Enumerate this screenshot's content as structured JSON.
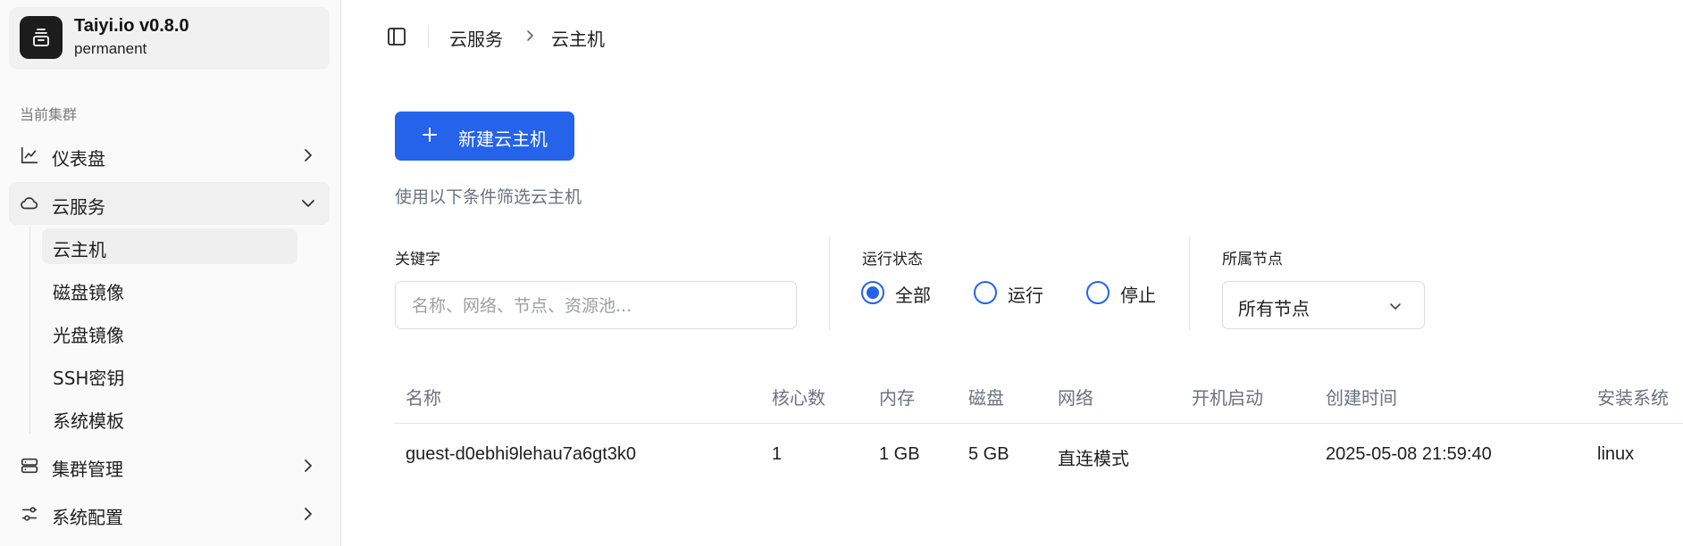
{
  "app": {
    "name": "Taiyi.io v0.8.0",
    "subtitle": "permanent"
  },
  "sidebar": {
    "section_label": "当前集群",
    "items": [
      {
        "label": "仪表盘",
        "icon": "chart-line-icon"
      },
      {
        "label": "云服务",
        "icon": "cloud-icon"
      },
      {
        "label": "集群管理",
        "icon": "server-icon"
      },
      {
        "label": "系统配置",
        "icon": "sliders-icon"
      }
    ],
    "subitems": [
      {
        "label": "云主机"
      },
      {
        "label": "磁盘镜像"
      },
      {
        "label": "光盘镜像"
      },
      {
        "label": "SSH密钥"
      },
      {
        "label": "系统模板"
      }
    ]
  },
  "breadcrumb": {
    "parent": "云服务",
    "current": "云主机"
  },
  "toolbar": {
    "new_button": "新建云主机"
  },
  "filters": {
    "hint": "使用以下条件筛选云主机",
    "keyword": {
      "label": "关键字",
      "placeholder": "名称、网络、节点、资源池..."
    },
    "status": {
      "label": "运行状态",
      "options": [
        {
          "label": "全部",
          "selected": true
        },
        {
          "label": "运行",
          "selected": false
        },
        {
          "label": "停止",
          "selected": false
        }
      ]
    },
    "node": {
      "label": "所属节点",
      "value": "所有节点"
    }
  },
  "table": {
    "headers": [
      "名称",
      "核心数",
      "内存",
      "磁盘",
      "网络",
      "开机启动",
      "创建时间",
      "安装系统"
    ],
    "rows": [
      [
        "guest-d0ebhi9lehau7a6gt3k0",
        "1",
        "1 GB",
        "5 GB",
        "直连模式",
        "",
        "2025-05-08 21:59:40",
        "linux"
      ]
    ]
  },
  "colors": {
    "accent": "#2563eb",
    "sidebar_bg": "#fafafa"
  }
}
